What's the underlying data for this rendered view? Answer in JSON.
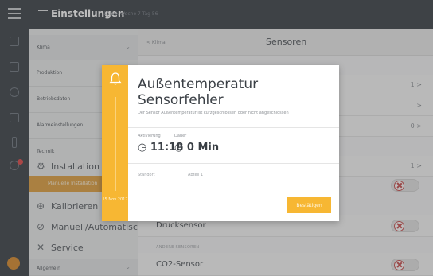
{
  "topbar": {
    "title": "Einstellungen",
    "subtitle": "11:18, Woche 7 Tag 56"
  },
  "sidebar": {
    "top_dropdown": "Klima",
    "items": [
      {
        "label": "Produktion"
      },
      {
        "label": "Betriebsdaten"
      },
      {
        "label": "Alarmeinstellungen"
      },
      {
        "label": "Technik"
      }
    ],
    "installation_label": "Installation",
    "active_item_label": "Manuelle Installation",
    "kalibrieren_label": "Kalibrieren",
    "manuell_label": "Manuell/Automatisch",
    "service_label": "Service",
    "bottom_dropdown": "Allgemein"
  },
  "main": {
    "back_label": "< Klima",
    "title": "Sensoren",
    "row_values": [
      "1 >",
      ">",
      "0 >",
      "1 >"
    ],
    "drucksensor_label": "Drucksensor",
    "caption": "ANDERE SENSOREN",
    "co2_label": "CO2-Sensor"
  },
  "modal": {
    "strip_date": "15 Nov 2017",
    "title_line1": "Außentemperatur",
    "title_line2": "Sensorfehler",
    "description": "Der Sensor Außentemperatur ist kurzgeschlossen oder nicht angeschlossen",
    "activation_label": "Aktivierung",
    "activation_value": "11:18",
    "duration_label": "Dauer",
    "duration_value": "0 Min",
    "location_label": "Standort",
    "location_value": "Abteil 1",
    "confirm_button": "Bestätigen"
  },
  "colors": {
    "accent": "#f7b733",
    "topbar": "#3b4148",
    "sidebar_active": "#e0a040",
    "error_toggle": "#c84c4c"
  }
}
